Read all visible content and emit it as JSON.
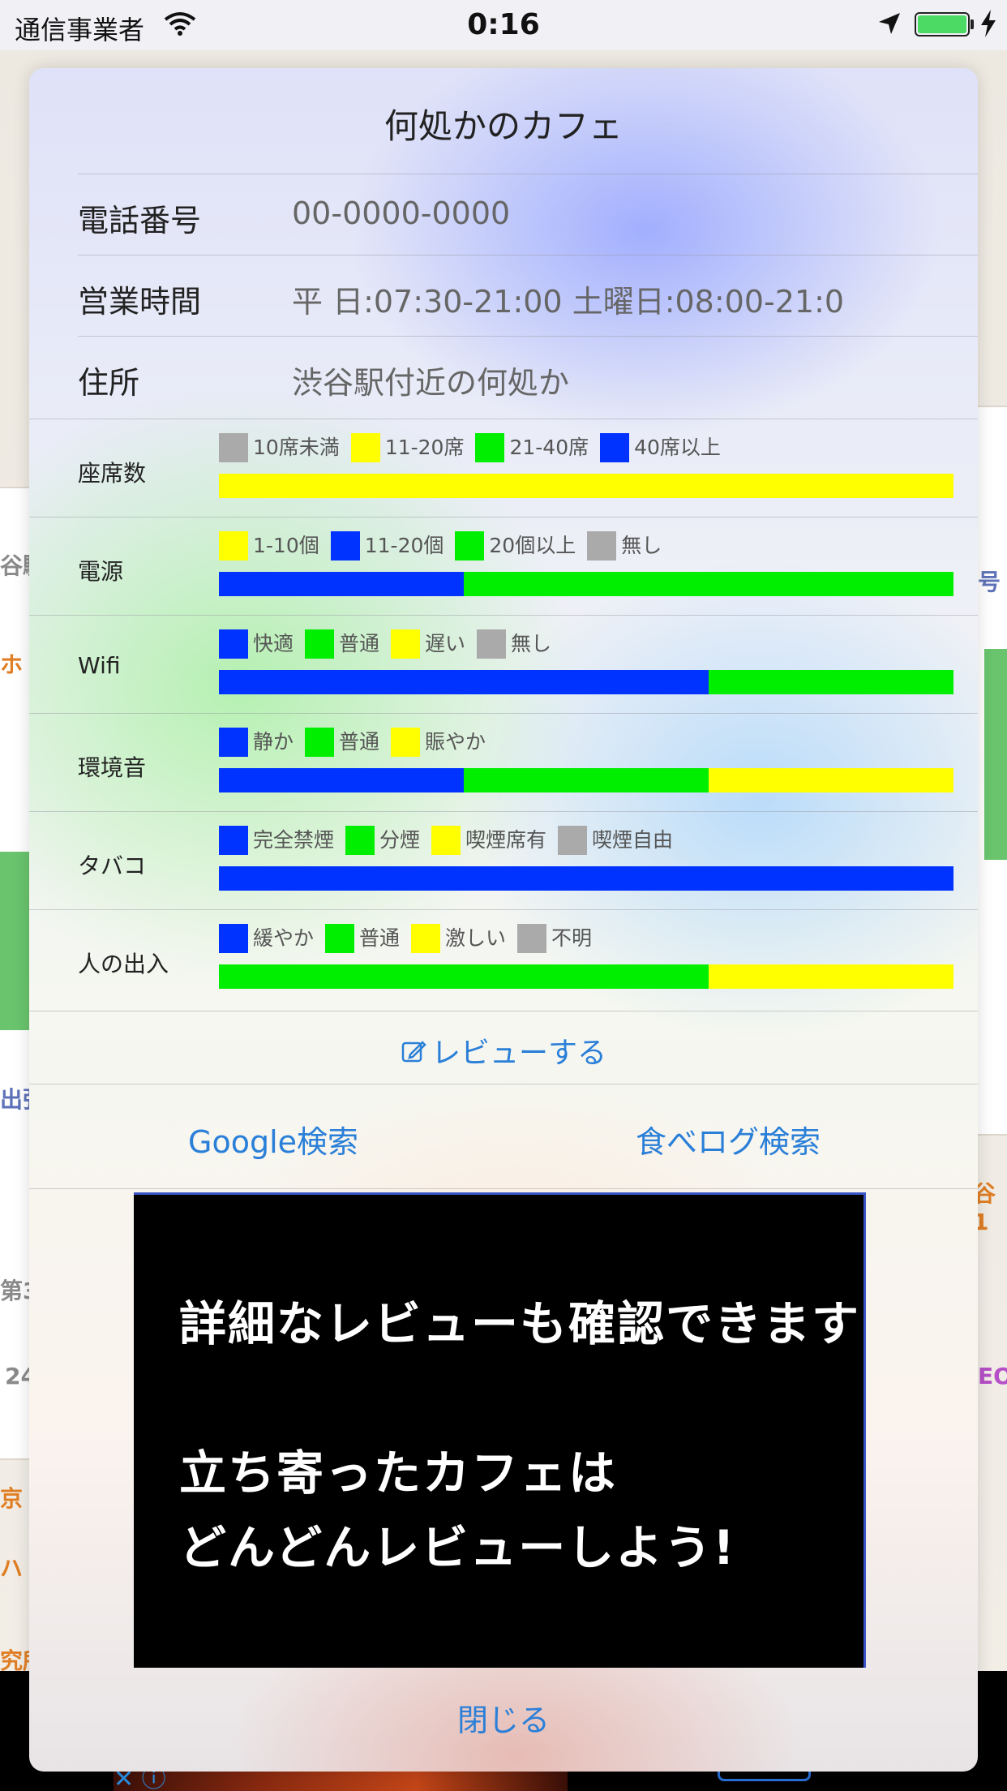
{
  "status_bar": {
    "carrier": "通信事業者",
    "time": "0:16",
    "battery_color": "#4cd964"
  },
  "map_labels": {
    "l1": "谷駅",
    "l2": "ホ",
    "l3": "出張",
    "l4": "第3",
    "l5": "24",
    "l6": "京",
    "l7": "ハ",
    "l8": "究所",
    "r1": "号",
    "r2": "谷1",
    "r3": "EO"
  },
  "card": {
    "title": "何処かのカフェ",
    "info": [
      {
        "key": "電話番号",
        "value": "00-0000-0000"
      },
      {
        "key": "営業時間",
        "value": "平 日:07:30-21:00 土曜日:08:00-21:0"
      },
      {
        "key": "住所",
        "value": "渋谷駅付近の何処か"
      }
    ],
    "ratings": [
      {
        "label": "座席数",
        "legend": [
          {
            "text": "10席未満",
            "color": "#aaaaaa"
          },
          {
            "text": "11-20席",
            "color": "#ffff00"
          },
          {
            "text": "21-40席",
            "color": "#00ee00"
          },
          {
            "text": "40席以上",
            "color": "#0033ff"
          }
        ],
        "distribution": [
          {
            "color": "#ffff00",
            "fraction": 1.0
          }
        ]
      },
      {
        "label": "電源",
        "legend": [
          {
            "text": "1-10個",
            "color": "#ffff00"
          },
          {
            "text": "11-20個",
            "color": "#0033ff"
          },
          {
            "text": "20個以上",
            "color": "#00ee00"
          },
          {
            "text": "無し",
            "color": "#aaaaaa"
          }
        ],
        "distribution": [
          {
            "color": "#0033ff",
            "fraction": 0.333
          },
          {
            "color": "#00ee00",
            "fraction": 0.667
          }
        ]
      },
      {
        "label": "Wifi",
        "legend": [
          {
            "text": "快適",
            "color": "#0033ff"
          },
          {
            "text": "普通",
            "color": "#00ee00"
          },
          {
            "text": "遅い",
            "color": "#ffff00"
          },
          {
            "text": "無し",
            "color": "#aaaaaa"
          }
        ],
        "distribution": [
          {
            "color": "#0033ff",
            "fraction": 0.667
          },
          {
            "color": "#00ee00",
            "fraction": 0.333
          }
        ]
      },
      {
        "label": "環境音",
        "legend": [
          {
            "text": "静か",
            "color": "#0033ff"
          },
          {
            "text": "普通",
            "color": "#00ee00"
          },
          {
            "text": "賑やか",
            "color": "#ffff00"
          }
        ],
        "distribution": [
          {
            "color": "#0033ff",
            "fraction": 0.333
          },
          {
            "color": "#00ee00",
            "fraction": 0.334
          },
          {
            "color": "#ffff00",
            "fraction": 0.333
          }
        ]
      },
      {
        "label": "タバコ",
        "legend": [
          {
            "text": "完全禁煙",
            "color": "#0033ff"
          },
          {
            "text": "分煙",
            "color": "#00ee00"
          },
          {
            "text": "喫煙席有",
            "color": "#ffff00"
          },
          {
            "text": "喫煙自由",
            "color": "#aaaaaa"
          }
        ],
        "distribution": [
          {
            "color": "#0033ff",
            "fraction": 1.0
          }
        ]
      },
      {
        "label": "人の出入",
        "legend": [
          {
            "text": "緩やか",
            "color": "#0033ff"
          },
          {
            "text": "普通",
            "color": "#00ee00"
          },
          {
            "text": "激しい",
            "color": "#ffff00"
          },
          {
            "text": "不明",
            "color": "#aaaaaa"
          }
        ],
        "distribution": [
          {
            "color": "#00ee00",
            "fraction": 0.667
          },
          {
            "color": "#ffff00",
            "fraction": 0.333
          }
        ]
      }
    ],
    "review_label": "レビューする",
    "google_search": "Google検索",
    "tabelog_search": "食べログ検索",
    "close_label": "閉じる"
  },
  "promo": {
    "line1": "詳細なレビューも確認できます",
    "line2": "立ち寄ったカフェは",
    "line3": "どんどんレビューしよう!"
  }
}
